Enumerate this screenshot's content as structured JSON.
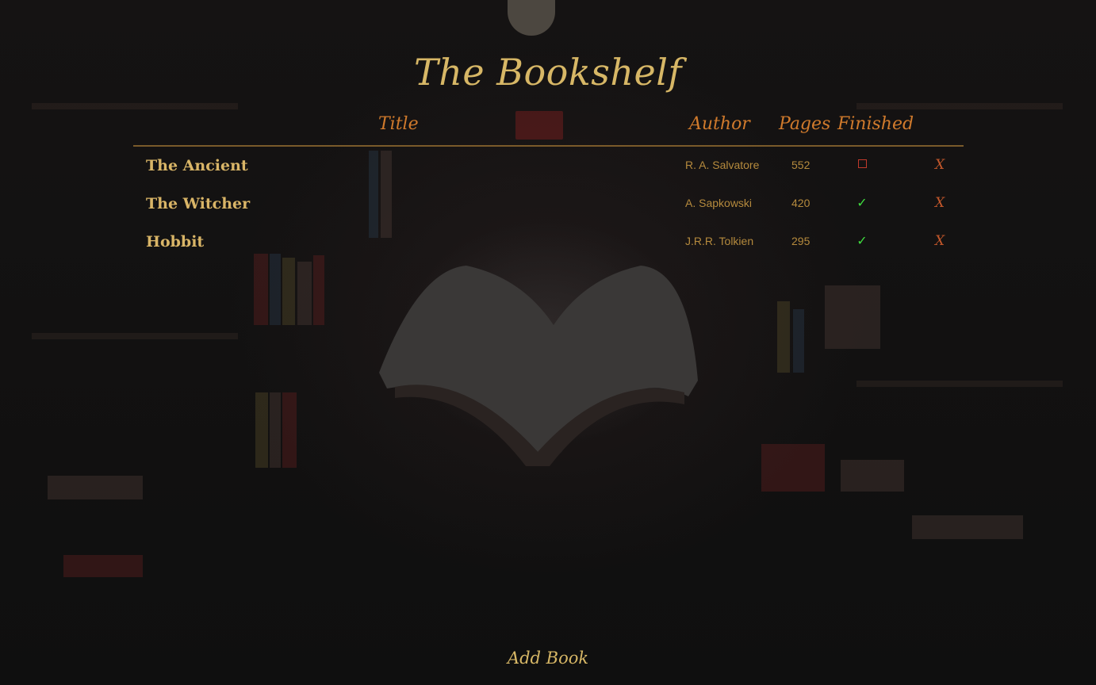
{
  "app": {
    "title": "The Bookshelf"
  },
  "table": {
    "headers": {
      "title": "Title",
      "author": "Author",
      "pages": "Pages",
      "finished": "Finished"
    },
    "rows": [
      {
        "title": "The Ancient",
        "author": "R. A. Salvatore",
        "pages": "552",
        "finished": false,
        "delete": "X"
      },
      {
        "title": "The Witcher",
        "author": "A. Sapkowski",
        "pages": "420",
        "finished": true,
        "delete": "X"
      },
      {
        "title": "Hobbit",
        "author": "J.R.R. Tolkien",
        "pages": "295",
        "finished": true,
        "delete": "X"
      }
    ],
    "finished_yes": "✓"
  },
  "actions": {
    "add_book": "Add Book"
  },
  "colors": {
    "title": "#d7b766",
    "header": "#d07a2c",
    "finished_yes": "#3fdc3f",
    "finished_no": "#c0392b",
    "delete": "#c0562a"
  },
  "icons": {
    "finished_yes": "checkmark-icon",
    "finished_no": "empty-checkbox-icon",
    "delete": "delete-x-icon"
  }
}
